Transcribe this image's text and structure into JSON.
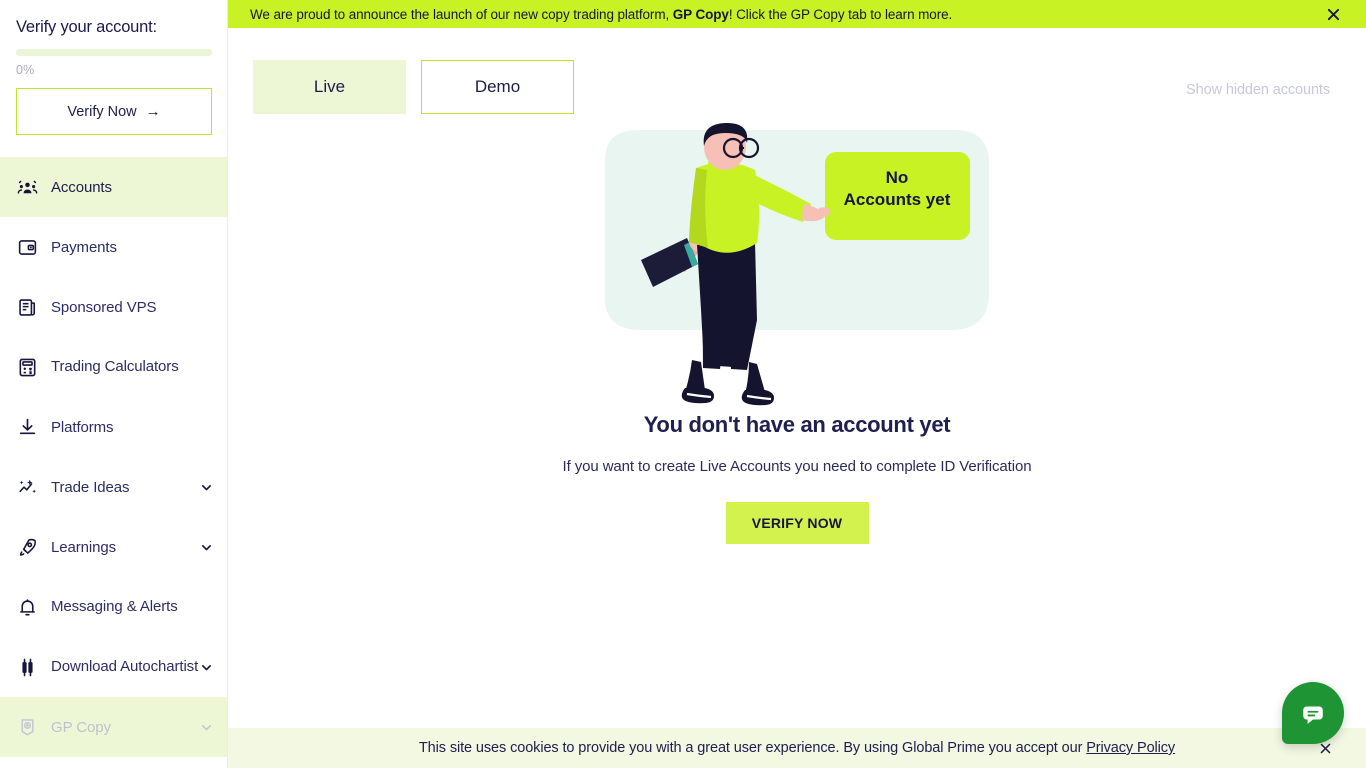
{
  "banner": {
    "text_before": "We are proud to announce the launch of our new copy trading platform, ",
    "brand": "GP Copy",
    "text_after": "! Click the GP Copy tab to learn more.",
    "close_icon": "close-icon",
    "background": "#c8f224"
  },
  "sidebar": {
    "verify": {
      "title": "Verify your account:",
      "progress_percent": "0%",
      "progress_value": 0,
      "button_label": "Verify Now",
      "button_arrow": "→"
    },
    "items": [
      {
        "label": "Accounts",
        "icon": "people-group-icon",
        "state": "active",
        "expandable": false
      },
      {
        "label": "Payments",
        "icon": "wallet-icon",
        "state": "normal",
        "expandable": false
      },
      {
        "label": "Sponsored VPS",
        "icon": "server-icon",
        "state": "normal",
        "expandable": false
      },
      {
        "label": "Trading Calculators",
        "icon": "calculator-icon",
        "state": "normal",
        "expandable": false
      },
      {
        "label": "Platforms",
        "icon": "download-icon",
        "state": "normal",
        "expandable": false
      },
      {
        "label": "Trade Ideas",
        "icon": "sparkle-chart-icon",
        "state": "normal",
        "expandable": true
      },
      {
        "label": "Learnings",
        "icon": "rocket-icon",
        "state": "normal",
        "expandable": true
      },
      {
        "label": "Messaging & Alerts",
        "icon": "bell-icon",
        "state": "normal",
        "expandable": false
      },
      {
        "label": "Download Autochartist",
        "icon": "candlestick-icon",
        "state": "normal",
        "expandable": true
      },
      {
        "label": "GP Copy",
        "icon": "copy-badge-icon",
        "state": "dimmed",
        "expandable": true
      }
    ]
  },
  "main": {
    "tabs": [
      {
        "label": "Live",
        "selected": true
      },
      {
        "label": "Demo",
        "selected": false
      }
    ],
    "show_hidden_accounts": "Show hidden accounts",
    "illustration": {
      "sign_line1": "No",
      "sign_line2": "Accounts yet",
      "sign_color": "#c8f224",
      "backdrop_color": "#e8f5f0"
    },
    "empty_title": "You don't have an account yet",
    "empty_subtitle": "If you want to create Live Accounts you need to complete ID Verification",
    "cta_label": "VERIFY NOW",
    "cta_color": "#d3f24d"
  },
  "cookie_bar": {
    "text": "This site uses cookies to provide you with a great user experience. By using Global Prime you accept our ",
    "link_label": "Privacy Policy",
    "close_icon": "close-icon"
  },
  "chat": {
    "icon": "chat-bubble-icon",
    "color": "#1f9434"
  }
}
